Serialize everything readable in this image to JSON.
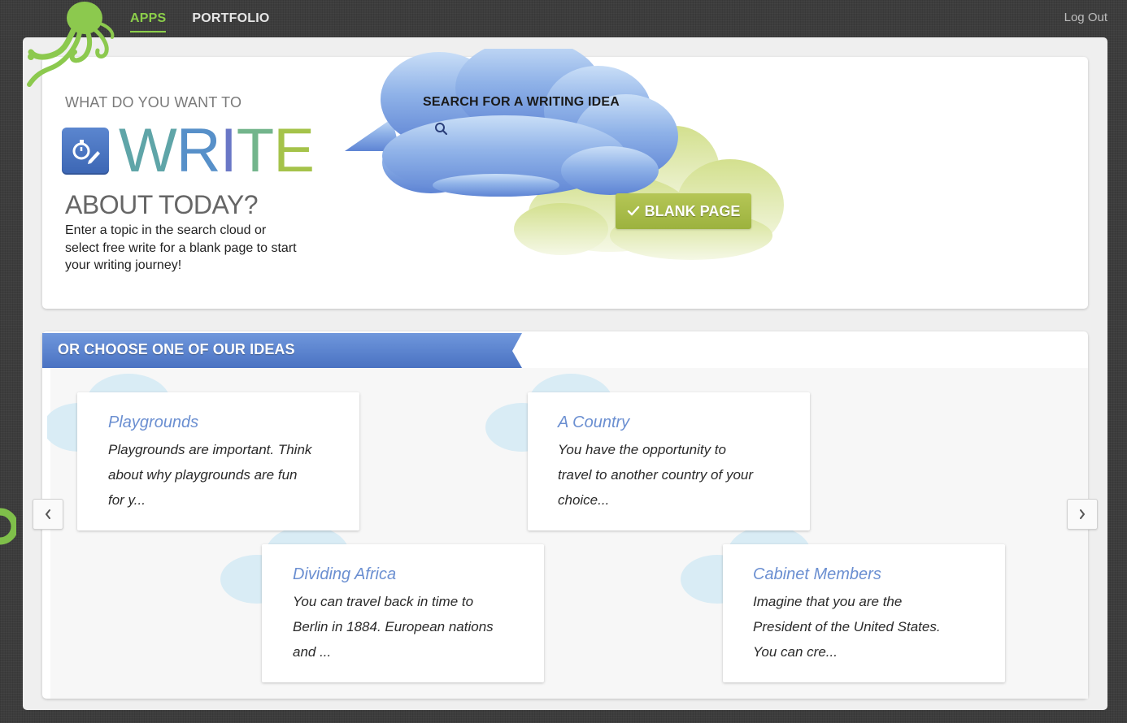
{
  "nav": {
    "apps": "APPS",
    "portfolio": "PORTFOLIO",
    "logout": "Log Out"
  },
  "colors": {
    "brand_green": "#8ccf4a",
    "accent_blue": "#5b86cf",
    "blank_green": "#a8bc48",
    "link_blue": "#6b8fd1"
  },
  "hero": {
    "question_top": "WHAT DO YOU WANT TO",
    "write_letters": [
      "W",
      "R",
      "I",
      "T",
      "E"
    ],
    "question_bottom": "ABOUT TODAY?",
    "description": "Enter a topic in the search cloud or select free write for a blank page to start your writing journey!",
    "app_icon": "stopwatch-pencil-icon"
  },
  "search": {
    "label": "SEARCH FOR A WRITING IDEA",
    "value": "",
    "icon": "search-icon"
  },
  "blank_page": {
    "label": "BLANK PAGE",
    "icon": "checkmark-icon"
  },
  "ideas": {
    "heading": "OR CHOOSE ONE OF OUR IDEAS",
    "items": [
      {
        "title": "Playgrounds",
        "lines": [
          "Playgrounds are important. Think",
          "about why playgrounds are fun",
          "for y..."
        ]
      },
      {
        "title": "A Country",
        "lines": [
          "You have the opportunity to",
          "travel to another country of your",
          "choice..."
        ]
      },
      {
        "title": "Dividing Africa",
        "lines": [
          "You can travel back in time to",
          "Berlin in 1884. European nations",
          "and ..."
        ]
      },
      {
        "title": "Cabinet Members",
        "lines": [
          "Imagine that you are the",
          "President of the United States.",
          "You can cre..."
        ]
      }
    ],
    "prev_icon": "chevron-left-icon",
    "next_icon": "chevron-right-icon"
  }
}
